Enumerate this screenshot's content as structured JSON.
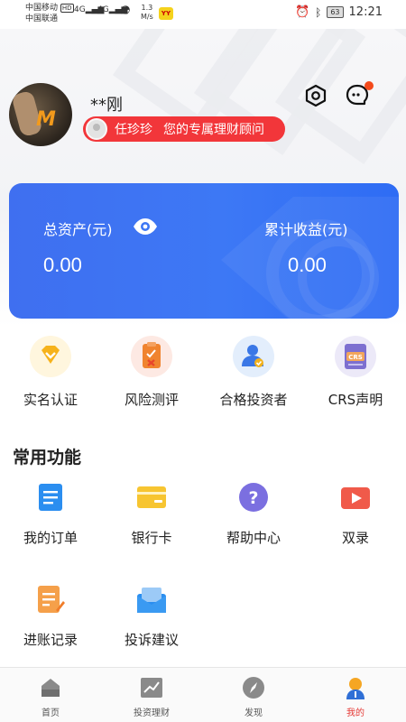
{
  "status_bar": {
    "carrier_1": "中国移动",
    "hd_badge": "HD",
    "carrier_2": "中国联通",
    "signal_1": "4G",
    "signal_2": "4G",
    "net_speed_value": "1.3",
    "net_speed_unit": "M/s",
    "app_badge": "YY",
    "battery": "63",
    "time": "12:21"
  },
  "profile": {
    "username": "**刚",
    "advisor_name": "任珍珍",
    "advisor_text": "您的专属理财顾问",
    "settings_icon": "settings-hex-icon",
    "message_icon": "message-bubble-icon",
    "message_dot_color": "#f44a1b"
  },
  "assets": {
    "total_label": "总资产(元)",
    "total_value": "0.00",
    "income_label": "累计收益(元)",
    "income_value": "0.00",
    "card_color": "#3d78f5"
  },
  "quick_actions": [
    {
      "label": "实名认证",
      "icon": "diamond-shield-icon"
    },
    {
      "label": "风险测评",
      "icon": "risk-report-icon"
    },
    {
      "label": "合格投资者",
      "icon": "investor-user-icon"
    },
    {
      "label": "CRS声明",
      "icon": "crs-document-icon"
    }
  ],
  "common_functions": {
    "title": "常用功能",
    "items": [
      {
        "label": "我的订单",
        "icon": "order-list-icon"
      },
      {
        "label": "银行卡",
        "icon": "bank-card-icon"
      },
      {
        "label": "帮助中心",
        "icon": "help-question-icon"
      },
      {
        "label": "双录",
        "icon": "video-record-icon"
      },
      {
        "label": "进账记录",
        "icon": "deposit-record-icon"
      },
      {
        "label": "投诉建议",
        "icon": "complaint-mail-icon"
      }
    ]
  },
  "tabbar": {
    "items": [
      {
        "label": "首页",
        "icon": "home-icon"
      },
      {
        "label": "投资理财",
        "icon": "invest-chart-icon"
      },
      {
        "label": "发现",
        "icon": "discover-compass-icon"
      },
      {
        "label": "我的",
        "icon": "profile-user-icon"
      }
    ],
    "active_color": "#e53935"
  }
}
